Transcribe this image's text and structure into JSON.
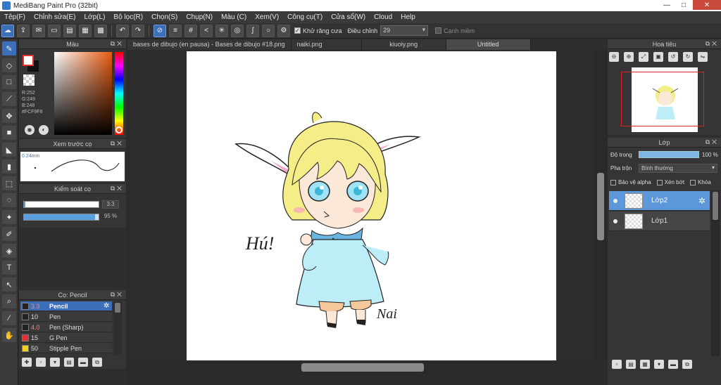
{
  "window": {
    "title": "MediBang Paint Pro (32bit)",
    "minimize": "—",
    "maximize": "□",
    "close": "✕"
  },
  "menu": [
    "Tệp(F)",
    "Chỉnh sửa(E)",
    "Lớp(L)",
    "Bộ lọc(R)",
    "Chọn(S)",
    "Chụp(N)",
    "Màu (C)",
    "Xem(V)",
    "Công cụ(T)",
    "Cửa sổ(W)",
    "Cloud",
    "Help"
  ],
  "toolbar": {
    "antialias_label": "Khử răng cưa",
    "antialias_checked": "✓",
    "adjust_label": "Điều chỉnh",
    "adjust_value": "29",
    "edge_label": "Cạnh mềm"
  },
  "color_panel": {
    "title": "Màu",
    "r": "R:252",
    "g": "G:249",
    "b": "B:248",
    "hex": "#FCF9F8",
    "fg_color": "#ffffff",
    "bg_color": "#111111"
  },
  "brush_preview": {
    "title": "Xem trước cọ",
    "size": "0.24mm"
  },
  "brush_control": {
    "title": "Kiểm soát cọ",
    "size_value": "3.3",
    "opacity_value": "95 %",
    "opacity_level": 0.95
  },
  "brush_list": {
    "title": "Cọ: Pencil",
    "items": [
      {
        "size": "3.3",
        "name": "Pencil",
        "color": "#222222",
        "selected": true
      },
      {
        "size": "10",
        "name": "Pen",
        "color": "#222222"
      },
      {
        "size": "4.0",
        "name": "Pen (Sharp)",
        "color": "#222222"
      },
      {
        "size": "15",
        "name": "G Pen",
        "color": "#e53030"
      },
      {
        "size": "50",
        "name": "Stipple Pen",
        "color": "#f0d020"
      }
    ]
  },
  "doc_tabs": [
    "bases de dibujo (en pausa) - Bases de dibujo #18.png",
    "naiki.png",
    "kiuoiy.png",
    "Untitled"
  ],
  "canvas": {
    "exclaim_text": "Hú!",
    "signature_text": "Nai"
  },
  "navigator": {
    "title": "Hoa tiêu"
  },
  "layer_panel": {
    "title": "Lớp",
    "opacity_label": "Độ trong",
    "opacity_value": "100 %",
    "blend_label": "Pha trộn",
    "blend_value": "Bình thường",
    "protect_alpha": "Bảo vệ alpha",
    "clipping": "Xén bớt",
    "lock": "Khóa",
    "layers": [
      {
        "name": "Lớp2",
        "selected": true
      },
      {
        "name": "Lớp1",
        "selected": false
      }
    ]
  },
  "icons": {
    "tools": [
      "brush-icon",
      "eraser-icon",
      "rect-icon",
      "dot-icon",
      "move-icon",
      "fill-rect-icon",
      "bucket-icon",
      "gradient-icon",
      "select-rect-icon",
      "lasso-icon",
      "magic-wand-icon",
      "select-pen-icon",
      "select-eraser-icon",
      "text-icon",
      "operation-icon",
      "dropper-icon",
      "eyedropper-icon",
      "hand-icon"
    ]
  },
  "colors": {
    "accent": "#3d6fb8",
    "selection": "#5b97d9",
    "nav_frame": "#dd2222"
  }
}
